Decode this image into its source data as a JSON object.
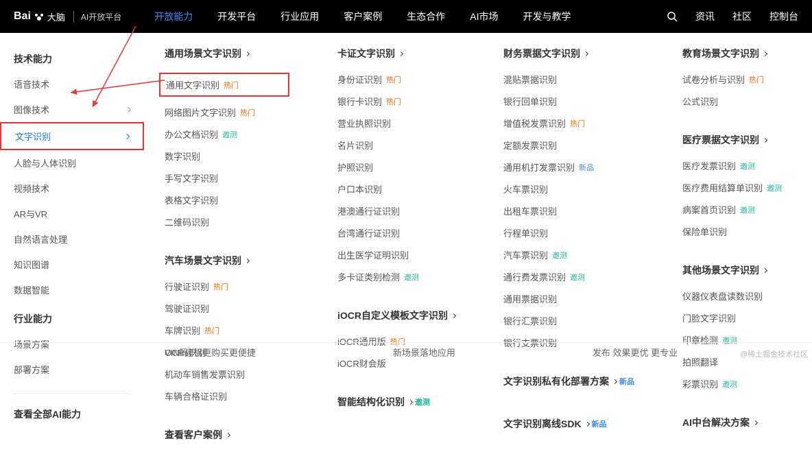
{
  "topbar": {
    "logo_main": "Bai",
    "logo_du": "大脑",
    "logo_sub": "AI开放平台",
    "nav": [
      "开放能力",
      "开发平台",
      "行业应用",
      "客户案例",
      "生态合作",
      "AI市场",
      "开发与教学"
    ],
    "right": [
      "资讯",
      "社区",
      "控制台"
    ]
  },
  "sidebar": {
    "head1": "技术能力",
    "items1": [
      "语音技术",
      "图像技术",
      "文字识别",
      "人脸与人体识别",
      "视频技术",
      "AR与VR",
      "自然语言处理",
      "知识图谱",
      "数据智能"
    ],
    "head2": "行业能力",
    "items2": [
      "场景方案",
      "部署方案"
    ],
    "footer": "查看全部AI能力"
  },
  "col1": {
    "cat1": "通用场景文字识别",
    "c1": [
      {
        "t": "通用文字识别",
        "g": "热门"
      },
      {
        "t": "网络图片文字识别",
        "g": "热门"
      },
      {
        "t": "办公文档识别",
        "g": "邀测"
      },
      {
        "t": "数字识别"
      },
      {
        "t": "手写文字识别"
      },
      {
        "t": "表格文字识别"
      },
      {
        "t": "二维码识别"
      }
    ],
    "cat2": "汽车场景文字识别",
    "c2": [
      {
        "t": "行驶证识别",
        "g": "热门"
      },
      {
        "t": "驾驶证识别"
      },
      {
        "t": "车牌识别",
        "g": "热门"
      },
      {
        "t": "VIN码识别"
      },
      {
        "t": "机动车销售发票识别"
      },
      {
        "t": "车辆合格证识别"
      }
    ],
    "cat3": "查看客户案例"
  },
  "col2": {
    "cat1": "卡证文字识别",
    "c1": [
      {
        "t": "身份证识别",
        "g": "热门"
      },
      {
        "t": "银行卡识别",
        "g": "热门"
      },
      {
        "t": "营业执照识别"
      },
      {
        "t": "名片识别"
      },
      {
        "t": "护照识别"
      },
      {
        "t": "户口本识别"
      },
      {
        "t": "港澳通行证识别"
      },
      {
        "t": "台湾通行证识别"
      },
      {
        "t": "出生医学证明识别"
      },
      {
        "t": "多卡证类别检测",
        "g": "邀测"
      }
    ],
    "cat2": "iOCR自定义模板文字识别",
    "c2": [
      {
        "t": "iOCR通用版",
        "g": "热门"
      },
      {
        "t": "iOCR财会版"
      }
    ],
    "cat3": "智能结构化识别",
    "g3": "邀测"
  },
  "col3": {
    "cat1": "财务票据文字识别",
    "c1": [
      {
        "t": "混贴票据识别"
      },
      {
        "t": "银行回单识别"
      },
      {
        "t": "增值税发票识别",
        "g": "热门"
      },
      {
        "t": "定额发票识别"
      },
      {
        "t": "通用机打发票识别",
        "g": "新品"
      },
      {
        "t": "火车票识别"
      },
      {
        "t": "出租车票识别"
      },
      {
        "t": "行程单识别"
      },
      {
        "t": "汽车票识别",
        "g": "邀测"
      },
      {
        "t": "通行费发票识别",
        "g": "邀测"
      },
      {
        "t": "通用票据识别"
      },
      {
        "t": "银行汇票识别"
      },
      {
        "t": "银行支票识别"
      }
    ],
    "cat2": "文字识别私有化部署方案",
    "g2": "新品",
    "cat3": "文字识别离线SDK",
    "g3": "新品"
  },
  "col4": {
    "cat1": "教育场景文字识别",
    "c1": [
      {
        "t": "试卷分析与识别",
        "g": "热门"
      },
      {
        "t": "公式识别"
      }
    ],
    "cat2": "医疗票据文字识别",
    "c2": [
      {
        "t": "医疗发票识别",
        "g": "邀测"
      },
      {
        "t": "医疗费用结算单识别",
        "g": "邀测"
      },
      {
        "t": "病案首页识别",
        "g": "邀测"
      },
      {
        "t": "保险单识别"
      }
    ],
    "cat3": "其他场景文字识别",
    "c3": [
      {
        "t": "仪器仪表盘读数识别"
      },
      {
        "t": "门脸文字识别"
      },
      {
        "t": "印章检测",
        "g": "邀测"
      },
      {
        "t": "拍照翻译"
      },
      {
        "t": "彩票识别",
        "g": "邀测"
      }
    ],
    "cat4": "AI中台解决方案"
  },
  "foot": [
    "OCR建机更购买更便捷",
    "新场景落地应用",
    "发布 效果更优 更专业"
  ],
  "watermark": "@稀土掘金技术社区"
}
